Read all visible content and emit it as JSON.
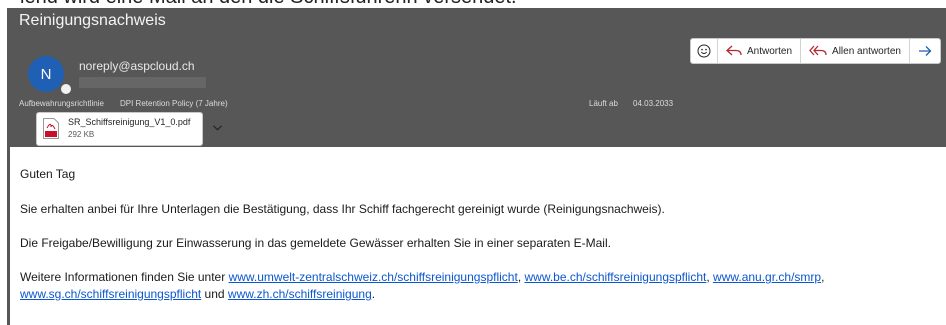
{
  "page_top_text": "iend wird eine Mail an den die Schiffsfuhrerin versendet.",
  "email": {
    "subject": "Reinigungsnachweis",
    "sender": {
      "avatar_initial": "N",
      "address": "noreply@aspcloud.ch"
    },
    "retention": {
      "label": "Aufbewahrungsrichtlinie",
      "value": "DPI Retention Policy (7 Jahre)"
    },
    "expiry": {
      "label": "Läuft ab",
      "date": "04.03.2033"
    },
    "toolbar": {
      "emoji_icon": "smiley-icon",
      "reply_label": "Antworten",
      "reply_all_label": "Allen antworten",
      "forward_icon": "forward-arrow-icon"
    },
    "attachment": {
      "filename": "SR_Schiffsreinigung_V1_0.pdf",
      "size": "292 KB",
      "icon": "pdf-icon"
    },
    "body": {
      "greeting": "Guten Tag",
      "paragraph1": "Sie erhalten anbei für Ihre Unterlagen die Bestätigung, dass Ihr Schiff fachgerecht gereinigt wurde (Reinigungsnachweis).",
      "paragraph2": "Die Freigabe/Bewilligung zur Einwasserung in das gemeldete Gewässer erhalten Sie in einer separaten E-Mail.",
      "info_prefix": "Weitere Informationen finden Sie unter ",
      "links": [
        "www.umwelt-zentralschweiz.ch/schiffsreinigungspflicht",
        "www.be.ch/schiffsreinigungspflicht",
        "www.anu.gr.ch/smrp",
        "www.sg.ch/schiffsreinigungspflicht",
        "www.zh.ch/schiffsreinigung"
      ],
      "sep_comma": ", ",
      "sep_und": " und ",
      "end_period": "."
    }
  },
  "colors": {
    "header_bg": "#575757",
    "avatar_bg": "#1f5fb4",
    "link": "#0b57d0",
    "pdf_red": "#c8102e"
  }
}
